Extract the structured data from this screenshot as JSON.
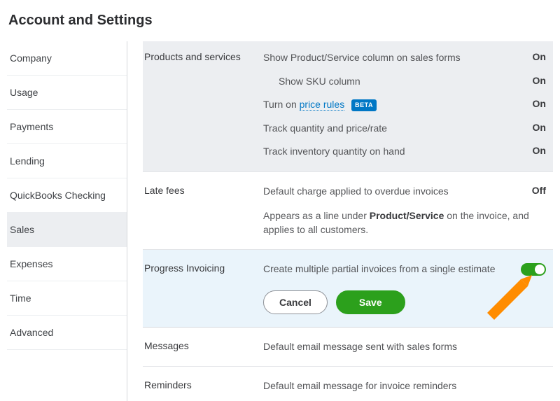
{
  "title": "Account and Settings",
  "sidebar": {
    "items": [
      {
        "label": "Company"
      },
      {
        "label": "Usage"
      },
      {
        "label": "Payments"
      },
      {
        "label": "Lending"
      },
      {
        "label": "QuickBooks Checking"
      },
      {
        "label": "Sales",
        "selected": true
      },
      {
        "label": "Expenses"
      },
      {
        "label": "Time"
      },
      {
        "label": "Advanced"
      }
    ]
  },
  "sections": {
    "products_services": {
      "label": "Products and services",
      "rows": [
        {
          "desc": "Show Product/Service column on sales forms",
          "state": "On"
        },
        {
          "desc": "Show SKU column",
          "state": "On",
          "indent": true
        },
        {
          "desc_prefix": "Turn on ",
          "link": "price rules",
          "badge": "BETA",
          "state": "On"
        },
        {
          "desc": "Track quantity and price/rate",
          "state": "On"
        },
        {
          "desc": "Track inventory quantity on hand",
          "state": "On"
        }
      ]
    },
    "late_fees": {
      "label": "Late fees",
      "row": {
        "desc": "Default charge applied to overdue invoices",
        "state": "Off"
      },
      "sub_pre": "Appears as a line under ",
      "sub_bold": "Product/Service",
      "sub_post": " on the invoice, and applies to all customers."
    },
    "progress_invoicing": {
      "label": "Progress Invoicing",
      "desc": "Create multiple partial invoices from a single estimate",
      "toggle_on": true,
      "cancel": "Cancel",
      "save": "Save"
    },
    "messages": {
      "label": "Messages",
      "desc": "Default email message sent with sales forms"
    },
    "reminders": {
      "label": "Reminders",
      "desc": "Default email message for invoice reminders"
    }
  }
}
